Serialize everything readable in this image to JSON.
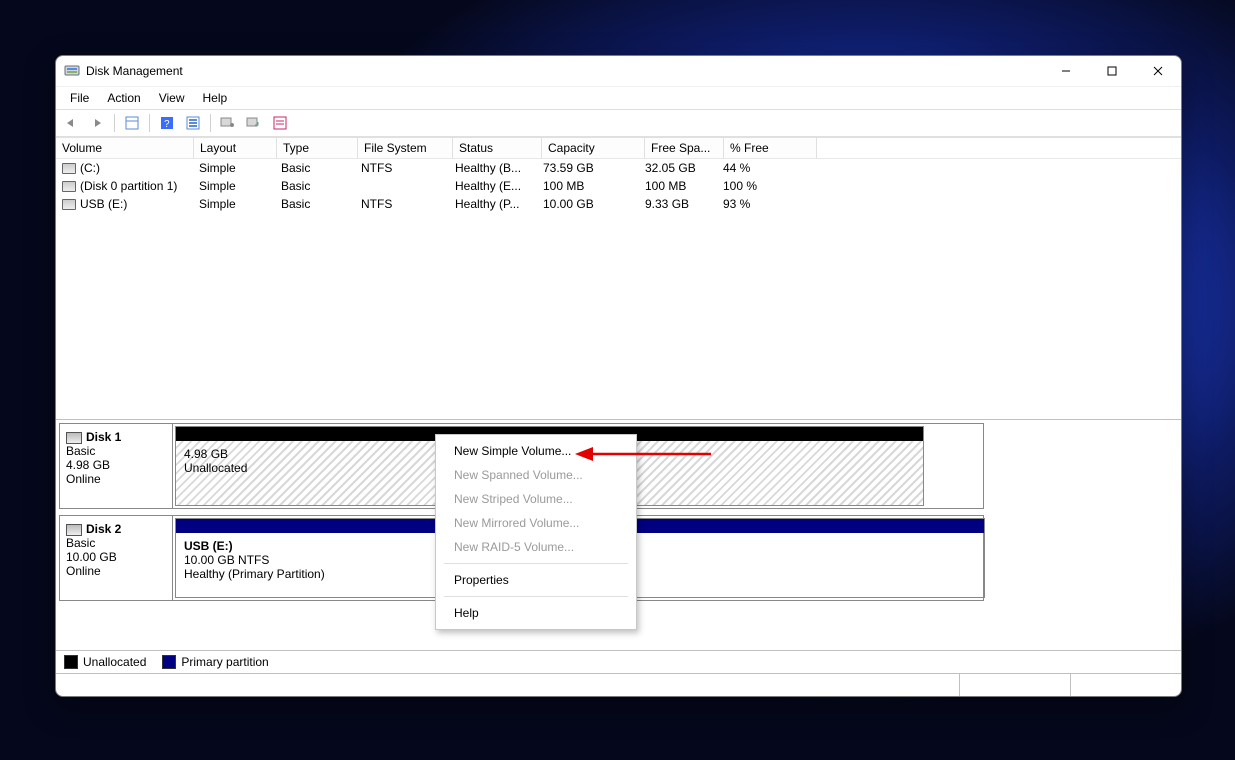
{
  "window": {
    "title": "Disk Management"
  },
  "menubar": [
    "File",
    "Action",
    "View",
    "Help"
  ],
  "columns": [
    "Volume",
    "Layout",
    "Type",
    "File System",
    "Status",
    "Capacity",
    "Free Spa...",
    "% Free"
  ],
  "volumes": [
    {
      "name": "(C:)",
      "layout": "Simple",
      "type": "Basic",
      "fs": "NTFS",
      "status": "Healthy (B...",
      "capacity": "73.59 GB",
      "free": "32.05 GB",
      "pct": "44 %"
    },
    {
      "name": "(Disk 0 partition 1)",
      "layout": "Simple",
      "type": "Basic",
      "fs": "",
      "status": "Healthy (E...",
      "capacity": "100 MB",
      "free": "100 MB",
      "pct": "100 %"
    },
    {
      "name": "USB (E:)",
      "layout": "Simple",
      "type": "Basic",
      "fs": "NTFS",
      "status": "Healthy (P...",
      "capacity": "10.00 GB",
      "free": "9.33 GB",
      "pct": "93 %"
    }
  ],
  "disks": [
    {
      "name": "Disk 1",
      "dtype": "Basic",
      "size": "4.98 GB",
      "state": "Online",
      "cap": "black",
      "partition": {
        "title": "",
        "line1": "4.98 GB",
        "line2": "Unallocated",
        "hatched": true
      }
    },
    {
      "name": "Disk 2",
      "dtype": "Basic",
      "size": "10.00 GB",
      "state": "Online",
      "cap": "navy",
      "partition": {
        "title": "USB  (E:)",
        "line1": "10.00 GB NTFS",
        "line2": "Healthy (Primary Partition)",
        "hatched": false
      }
    }
  ],
  "legend": [
    {
      "color": "black",
      "label": "Unallocated"
    },
    {
      "color": "navy",
      "label": "Primary partition"
    }
  ],
  "context_menu": [
    {
      "label": "New Simple Volume...",
      "enabled": true
    },
    {
      "label": "New Spanned Volume...",
      "enabled": false
    },
    {
      "label": "New Striped Volume...",
      "enabled": false
    },
    {
      "label": "New Mirrored Volume...",
      "enabled": false
    },
    {
      "label": "New RAID-5 Volume...",
      "enabled": false
    },
    {
      "sep": true
    },
    {
      "label": "Properties",
      "enabled": true
    },
    {
      "sep": true
    },
    {
      "label": "Help",
      "enabled": true
    }
  ]
}
